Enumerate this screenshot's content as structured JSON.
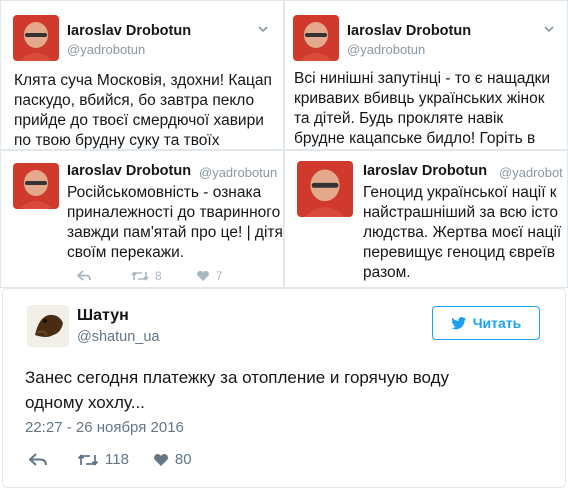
{
  "colors": {
    "twitter_blue": "#1da1f2",
    "text": "#14171a",
    "muted": "#8899a6",
    "border": "#e1e8ed"
  },
  "tweet_a": {
    "name": "Iaroslav Drobotun",
    "handle": "@yadrobotun",
    "lines": [
      "Клята суча Московія, здохни! Кацап",
      "паскудо, вбийся, бо завтра пекло",
      "прийде до твоєї смердючої хавири",
      "по твою брудну суку та твоїх"
    ]
  },
  "tweet_b": {
    "name": "Iaroslav Drobotun",
    "handle": "@yadrobotun",
    "lines": [
      "Всі нинішні запутінці - то є нащадки",
      "кривавих вбивць українських жінок",
      "та дітей. Будь прокляте навік",
      "брудне кацапське бидло! Горіть в"
    ]
  },
  "tweet_c": {
    "name": "Iaroslav Drobotun",
    "handle": "@yadrobotun",
    "lines": [
      "Російськомовність - ознака",
      "приналежності до тваринного",
      "завжди пам'ятай про це! | дітя",
      "своїм перекажи."
    ],
    "retweets": "8",
    "likes": "7"
  },
  "tweet_d": {
    "name": "Iaroslav Drobotun",
    "handle": "@yadrobot",
    "lines": [
      "Геноцид української нації к",
      "найстрашніший за всю істо",
      "людства. Жертва моєї нації",
      "перевищує геноцид євреїв",
      "разом."
    ]
  },
  "main_tweet": {
    "name": "Шатун",
    "handle": "@shatun_ua",
    "follow_label": "Читать",
    "lines": [
      "Занес сегодня платежку за отопление и горячую воду",
      "одному хохлу..."
    ],
    "timestamp": "22:27 - 26 ноября 2016",
    "retweets": "118",
    "likes": "80"
  }
}
